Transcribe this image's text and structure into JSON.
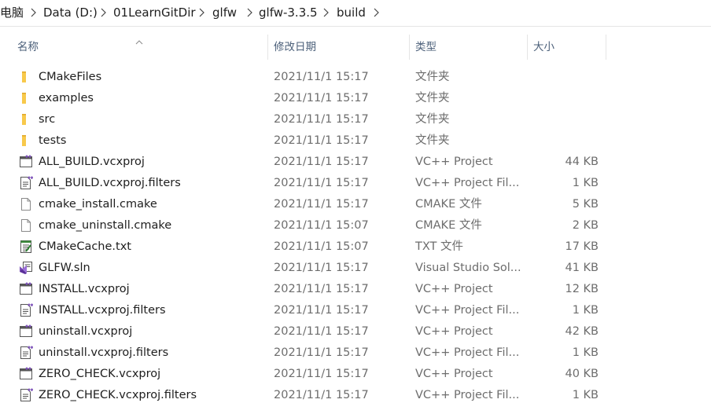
{
  "breadcrumb": [
    "电脑",
    "Data (D:)",
    "01LearnGitDir",
    "glfw",
    "glfw-3.3.5",
    "build"
  ],
  "columns": {
    "name": "名称",
    "date": "修改日期",
    "type": "类型",
    "size": "大小"
  },
  "files": [
    {
      "name": "CMakeFiles",
      "date": "2021/11/1 15:17",
      "type": "文件夹",
      "size": "",
      "icon": "folder-icon"
    },
    {
      "name": "examples",
      "date": "2021/11/1 15:17",
      "type": "文件夹",
      "size": "",
      "icon": "folder-icon"
    },
    {
      "name": "src",
      "date": "2021/11/1 15:17",
      "type": "文件夹",
      "size": "",
      "icon": "folder-icon"
    },
    {
      "name": "tests",
      "date": "2021/11/1 15:17",
      "type": "文件夹",
      "size": "",
      "icon": "folder-icon"
    },
    {
      "name": "ALL_BUILD.vcxproj",
      "date": "2021/11/1 15:17",
      "type": "VC++ Project",
      "size": "44 KB",
      "icon": "vcxproj-icon"
    },
    {
      "name": "ALL_BUILD.vcxproj.filters",
      "date": "2021/11/1 15:17",
      "type": "VC++ Project Fil...",
      "size": "1 KB",
      "icon": "filters-icon"
    },
    {
      "name": "cmake_install.cmake",
      "date": "2021/11/1 15:17",
      "type": "CMAKE 文件",
      "size": "5 KB",
      "icon": "file-icon"
    },
    {
      "name": "cmake_uninstall.cmake",
      "date": "2021/11/1 15:07",
      "type": "CMAKE 文件",
      "size": "2 KB",
      "icon": "file-icon"
    },
    {
      "name": "CMakeCache.txt",
      "date": "2021/11/1 15:07",
      "type": "TXT 文件",
      "size": "17 KB",
      "icon": "text-file-icon"
    },
    {
      "name": "GLFW.sln",
      "date": "2021/11/1 15:17",
      "type": "Visual Studio Sol...",
      "size": "41 KB",
      "icon": "sln-icon"
    },
    {
      "name": "INSTALL.vcxproj",
      "date": "2021/11/1 15:17",
      "type": "VC++ Project",
      "size": "12 KB",
      "icon": "vcxproj-icon"
    },
    {
      "name": "INSTALL.vcxproj.filters",
      "date": "2021/11/1 15:17",
      "type": "VC++ Project Fil...",
      "size": "1 KB",
      "icon": "filters-icon"
    },
    {
      "name": "uninstall.vcxproj",
      "date": "2021/11/1 15:17",
      "type": "VC++ Project",
      "size": "42 KB",
      "icon": "vcxproj-icon"
    },
    {
      "name": "uninstall.vcxproj.filters",
      "date": "2021/11/1 15:17",
      "type": "VC++ Project Fil...",
      "size": "1 KB",
      "icon": "filters-icon"
    },
    {
      "name": "ZERO_CHECK.vcxproj",
      "date": "2021/11/1 15:17",
      "type": "VC++ Project",
      "size": "40 KB",
      "icon": "vcxproj-icon"
    },
    {
      "name": "ZERO_CHECK.vcxproj.filters",
      "date": "2021/11/1 15:17",
      "type": "VC++ Project Fil...",
      "size": "1 KB",
      "icon": "filters-icon"
    }
  ],
  "colors": {
    "folder": "#f8c94b",
    "header_text": "#4c607a",
    "detail_text": "#6d6d6d",
    "vs_purple": "#7b4fb8"
  }
}
